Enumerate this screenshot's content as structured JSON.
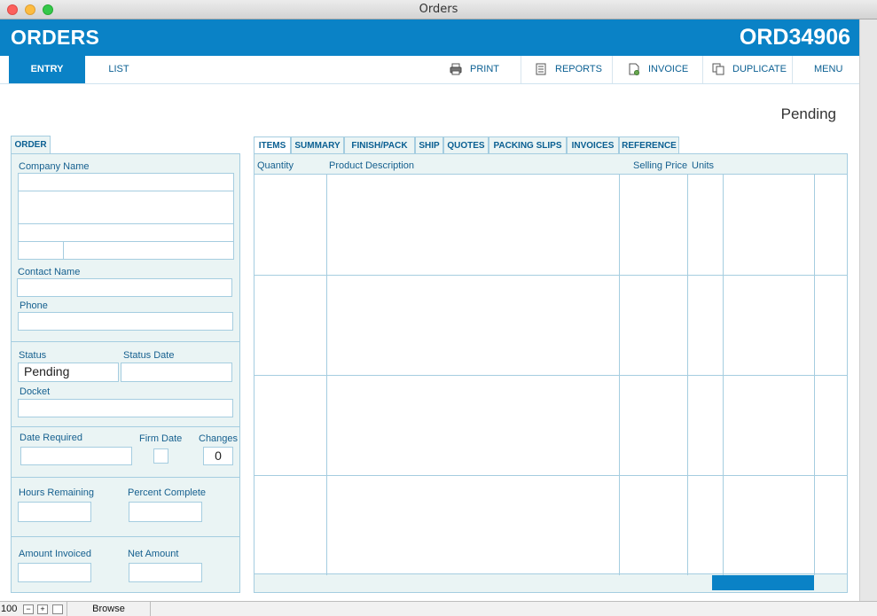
{
  "window": {
    "title": "Orders"
  },
  "header": {
    "title": "ORDERS",
    "order_id": "ORD34906"
  },
  "nav": {
    "tabs": [
      {
        "label": "ENTRY",
        "active": true
      },
      {
        "label": "LIST",
        "active": false
      }
    ],
    "buttons": [
      {
        "label": "PRINT",
        "icon": "printer-icon"
      },
      {
        "label": "REPORTS",
        "icon": "reports-icon"
      },
      {
        "label": "INVOICE",
        "icon": "invoice-icon"
      },
      {
        "label": "DUPLICATE",
        "icon": "duplicate-icon"
      },
      {
        "label": "MENU",
        "icon": ""
      }
    ]
  },
  "status_display": "Pending",
  "order_panel": {
    "tab_label": "ORDER",
    "company_name_label": "Company Name",
    "contact_name_label": "Contact Name",
    "phone_label": "Phone",
    "status_label": "Status",
    "status_value": "Pending",
    "status_date_label": "Status Date",
    "docket_label": "Docket",
    "date_required_label": "Date Required",
    "firm_date_label": "Firm Date",
    "changes_label": "Changes",
    "changes_value": "0",
    "hours_remaining_label": "Hours Remaining",
    "percent_complete_label": "Percent Complete",
    "amount_invoiced_label": "Amount Invoiced",
    "net_amount_label": "Net Amount"
  },
  "item_tabs": [
    "ITEMS",
    "SUMMARY",
    "FINISH/PACK",
    "SHIP",
    "QUOTES",
    "PACKING SLIPS",
    "INVOICES",
    "REFERENCE"
  ],
  "items_columns": {
    "quantity": "Quantity",
    "product_description": "Product Description",
    "selling_price": "Selling Price",
    "units": "Units"
  },
  "bottom": {
    "zoom": "100",
    "mode": "Browse"
  },
  "colors": {
    "accent": "#0a82c6",
    "panel": "#eaf4f4",
    "border": "#a5cde0"
  }
}
